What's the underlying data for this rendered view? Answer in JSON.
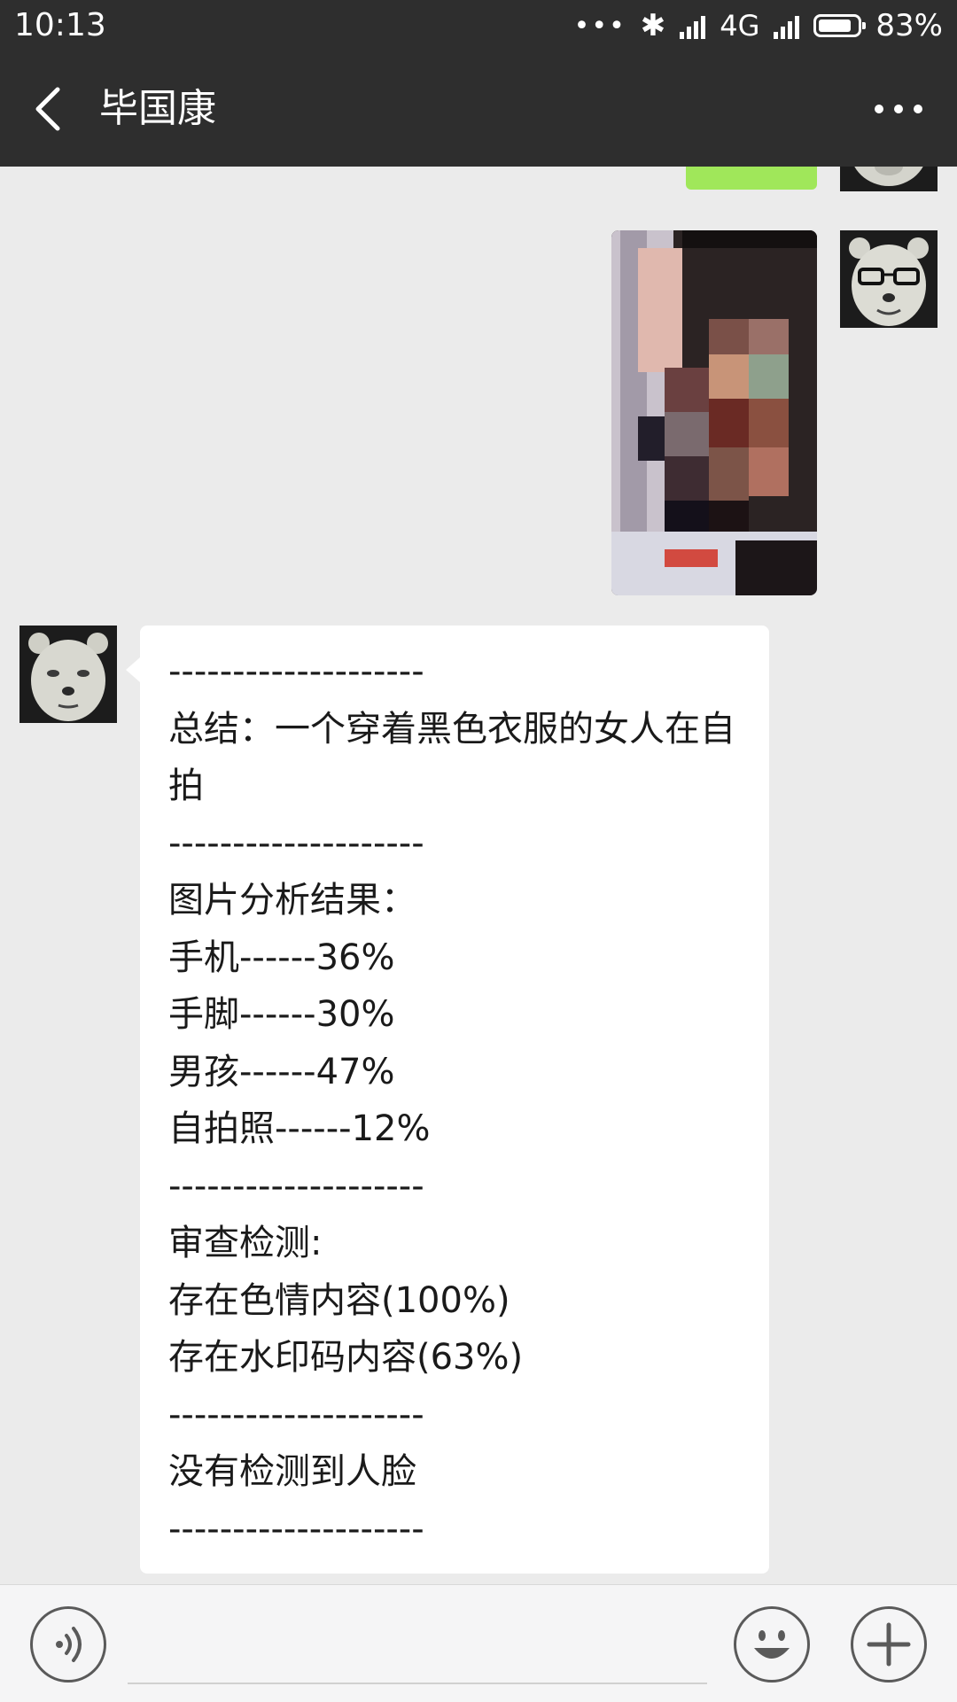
{
  "status_bar": {
    "time": "10:13",
    "notification_dots": "•••",
    "bluetooth_symbol": "✱",
    "network": "4G",
    "battery_percent": "83%",
    "battery_level": 0.83
  },
  "header": {
    "title": "毕国康",
    "back_icon": "chevron-left-icon",
    "more_icon": "more-dots-icon"
  },
  "colors": {
    "header_bg": "#2e2e2e",
    "chat_bg": "#ebebeb",
    "sent_bubble": "#a0e75a",
    "received_bubble": "#ffffff"
  },
  "messages": {
    "received_text_lines": [
      "--------------------",
      "总结：一个穿着黑色衣服的女人在自拍",
      "--------------------",
      "图片分析结果：",
      "手机------36%",
      "手脚------30%",
      "男孩------47%",
      "自拍照------12%",
      "--------------------",
      "审查检测:",
      "存在色情内容(100%)",
      "存在水印码内容(63%)",
      "--------------------",
      "没有检测到人脸",
      "--------------------"
    ]
  },
  "input_bar": {
    "voice_icon": "voice-icon",
    "emoji_icon": "emoji-icon",
    "plus_icon": "plus-icon"
  }
}
